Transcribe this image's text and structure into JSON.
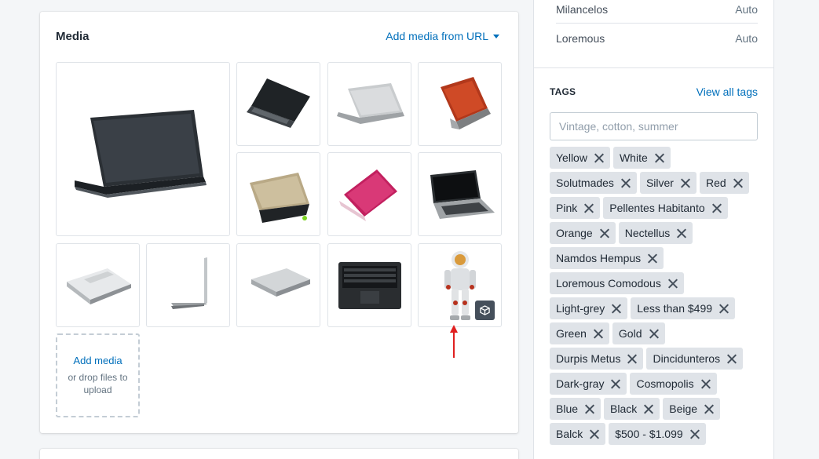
{
  "media": {
    "title": "Media",
    "add_from_url": "Add media from URL",
    "add_media": "Add media",
    "drop_hint": "or drop files to upload",
    "items": [
      {
        "name": "laptop-image-1",
        "kind": "black-back-large"
      },
      {
        "name": "laptop-image-2",
        "kind": "black-back"
      },
      {
        "name": "laptop-image-3",
        "kind": "silver-back"
      },
      {
        "name": "laptop-image-4",
        "kind": "orange-back"
      },
      {
        "name": "laptop-image-5",
        "kind": "gold-open"
      },
      {
        "name": "laptop-image-6",
        "kind": "pink-back"
      },
      {
        "name": "laptop-image-7",
        "kind": "black-front"
      },
      {
        "name": "laptop-image-8",
        "kind": "white-closed"
      },
      {
        "name": "laptop-image-9",
        "kind": "silver-side"
      },
      {
        "name": "laptop-image-10",
        "kind": "silver-closed"
      },
      {
        "name": "laptop-image-11",
        "kind": "black-top"
      },
      {
        "name": "astronaut-3d-model",
        "kind": "astronaut"
      }
    ]
  },
  "channels": [
    {
      "name": "Milancelos",
      "value": "Auto"
    },
    {
      "name": "Loremous",
      "value": "Auto"
    }
  ],
  "tags": {
    "heading": "TAGS",
    "view_all": "View all tags",
    "placeholder": "Vintage, cotton, summer",
    "rows": [
      [
        "Yellow",
        "White"
      ],
      [
        "Solutmades",
        "Silver",
        "Red"
      ],
      [
        "Pink",
        "Pellentes Habitanto"
      ],
      [
        "Orange",
        "Nectellus"
      ],
      [
        "Namdos Hempus"
      ],
      [
        "Loremous Comodous"
      ],
      [
        "Light-grey",
        "Less than $499"
      ],
      [
        "Green",
        "Gold"
      ],
      [
        "Durpis Metus",
        "Dincidunteros"
      ],
      [
        "Dark-gray",
        "Cosmopolis"
      ],
      [
        "Blue",
        "Black",
        "Beige"
      ],
      [
        "Balck",
        "$500 - $1.099"
      ]
    ]
  },
  "colors": {
    "accent": "#006fbb",
    "tag_bg": "#dfe3e8",
    "arrow": "#e02020"
  }
}
